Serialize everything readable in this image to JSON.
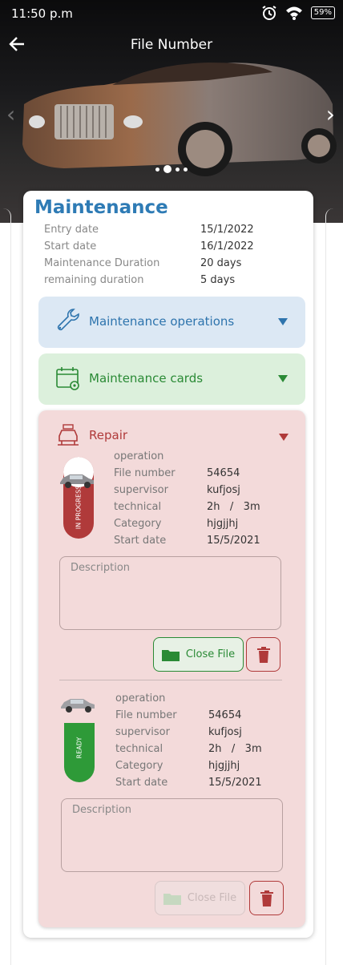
{
  "status": {
    "time": "11:50 p.m",
    "battery": "59%"
  },
  "header": {
    "title": "File Number"
  },
  "maintenance": {
    "title": "Maintenance",
    "info": [
      {
        "label": "Entry date",
        "value": "15/1/2022"
      },
      {
        "label": "Start date",
        "value": "16/1/2022"
      },
      {
        "label": "Maintenance Duration",
        "value": "20 days"
      },
      {
        "label": "remaining duration",
        "value": "5 days"
      }
    ],
    "operations_label": "Maintenance operations",
    "cards_label": "Maintenance cards",
    "repair_label": "Repair",
    "items": [
      {
        "status": "IN PROGRESS",
        "status_color": "#b03a3a",
        "operation_label": "operation",
        "fields": [
          {
            "label": "File number",
            "value": "54654"
          },
          {
            "label": "supervisor",
            "value": "kufjosj"
          },
          {
            "label": "technical",
            "value": "2h   /   3m"
          },
          {
            "label": "Category",
            "value": "hjgjjhj"
          },
          {
            "label": "Start date",
            "value": "15/5/2021"
          }
        ],
        "description_placeholder": "Description",
        "close_label": "Close File"
      },
      {
        "status": "READY",
        "status_color": "#2e9a38",
        "operation_label": "operation",
        "fields": [
          {
            "label": "File number",
            "value": "54654"
          },
          {
            "label": "supervisor",
            "value": "kufjosj"
          },
          {
            "label": "technical",
            "value": "2h   /   3m"
          },
          {
            "label": "Category",
            "value": "hjgjjhj"
          },
          {
            "label": "Start date",
            "value": "15/5/2021"
          }
        ],
        "description_placeholder": "Description",
        "close_label": "Close File"
      }
    ]
  },
  "colors": {
    "accent_blue": "#2e7bb5",
    "green": "#2a8a35",
    "red": "#b03a3a"
  },
  "icons": [
    "back-arrow-icon",
    "alarm-icon",
    "wifi-icon",
    "battery-icon",
    "wrench-icon",
    "calendar-gear-icon",
    "car-lift-icon",
    "folder-icon",
    "trash-icon",
    "car-icon"
  ]
}
